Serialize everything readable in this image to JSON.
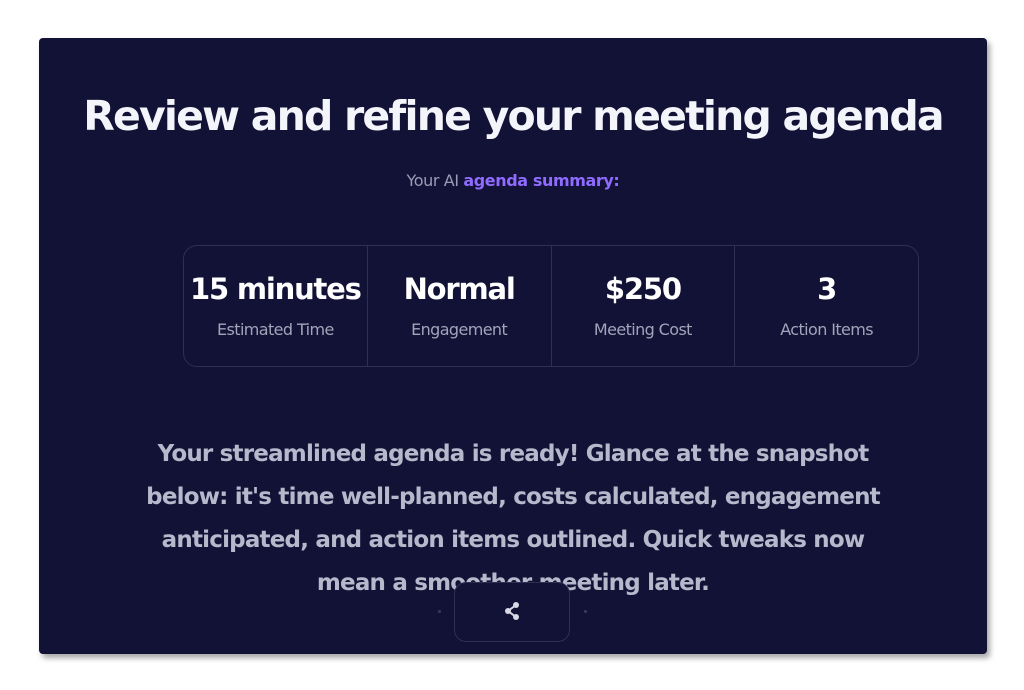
{
  "header": {
    "title": "Review and refine your meeting agenda",
    "subtitle_prefix": "Your AI ",
    "subtitle_highlight": "agenda summary:"
  },
  "stats": [
    {
      "value": "15 minutes",
      "label": "Estimated Time"
    },
    {
      "value": "Normal",
      "label": "Engagement"
    },
    {
      "value": "$250",
      "label": "Meeting Cost"
    },
    {
      "value": "3",
      "label": "Action Items"
    }
  ],
  "description": "Your streamlined agenda is ready! Glance at the snapshot below: it's time well-planned, costs calculated, engagement anticipated, and action items outlined. Quick tweaks now mean a smoother meeting later.",
  "actions": {
    "share_icon": "share-icon"
  },
  "colors": {
    "panel_bg": "#121236",
    "accent": "#8f6bff",
    "title": "#f4f4fb",
    "muted": "#a3a3ba"
  }
}
